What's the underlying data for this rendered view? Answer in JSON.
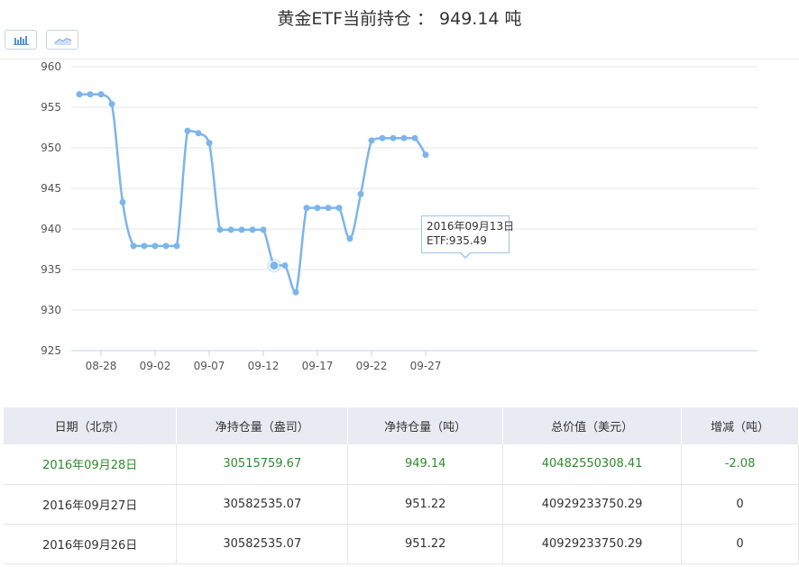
{
  "header": {
    "title": "黄金ETF当前持仓 ： 949.14 吨"
  },
  "controls": {
    "bar_icon": "bar-chart-icon",
    "line_icon": "line-chart-icon"
  },
  "chart_data": {
    "type": "line",
    "x": [
      "08-26",
      "08-27",
      "08-28",
      "08-29",
      "08-30",
      "08-31",
      "09-01",
      "09-02",
      "09-03",
      "09-04",
      "09-05",
      "09-06",
      "09-07",
      "09-08",
      "09-09",
      "09-10",
      "09-11",
      "09-12",
      "09-13",
      "09-14",
      "09-15",
      "09-16",
      "09-17",
      "09-18",
      "09-19",
      "09-20",
      "09-21",
      "09-22",
      "09-23",
      "09-24",
      "09-25",
      "09-26",
      "09-27"
    ],
    "xticks": [
      "08-28",
      "09-02",
      "09-07",
      "09-12",
      "09-17",
      "09-22",
      "09-27"
    ],
    "series": [
      {
        "values": [
          956.6,
          956.6,
          956.6,
          955.4,
          943.3,
          937.9,
          937.9,
          937.9,
          937.9,
          937.9,
          952.1,
          951.8,
          950.6,
          939.9,
          939.9,
          939.9,
          939.9,
          939.9,
          935.49,
          935.5,
          932.2,
          942.6,
          942.6,
          942.6,
          942.6,
          938.8,
          944.3,
          950.9,
          951.2,
          951.2,
          951.2,
          951.2,
          949.14
        ],
        "color": "#7cb5ec"
      }
    ],
    "ylim": [
      925,
      960
    ],
    "yticks": [
      925,
      930,
      935,
      940,
      945,
      950,
      955,
      960
    ],
    "grid": true
  },
  "tooltip": {
    "date": "2016年09月13日",
    "value": "ETF:935.49"
  },
  "table": {
    "headers": [
      "日期（北京）",
      "净持仓量（盎司）",
      "净持仓量（吨）",
      "总价值（美元）",
      "增减（吨）"
    ],
    "rows": [
      [
        "2016年09月28日",
        "30515759.67",
        "949.14",
        "40482550308.41",
        "-2.08"
      ],
      [
        "2016年09月27日",
        "30582535.07",
        "951.22",
        "40929233750.29",
        "0"
      ],
      [
        "2016年09月26日",
        "30582535.07",
        "951.22",
        "40929233750.29",
        "0"
      ]
    ]
  }
}
